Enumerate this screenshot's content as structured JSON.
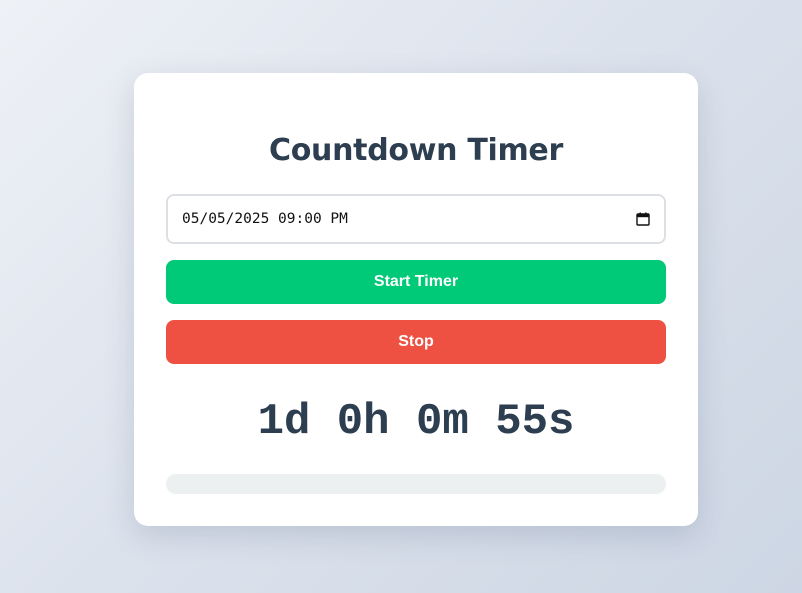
{
  "timer": {
    "title": "Countdown Timer",
    "datetime_value": "05/05/2025 09:00 PM",
    "start_label": "Start Timer",
    "stop_label": "Stop",
    "countdown_text": "1d 0h 0m 55s",
    "progress_percent": 0
  },
  "icons": {
    "calendar": "calendar-icon"
  },
  "colors": {
    "start_button": "#00c977",
    "stop_button": "#ee5142",
    "title_text": "#2c3e50",
    "progress_track": "#ecf0f1"
  }
}
